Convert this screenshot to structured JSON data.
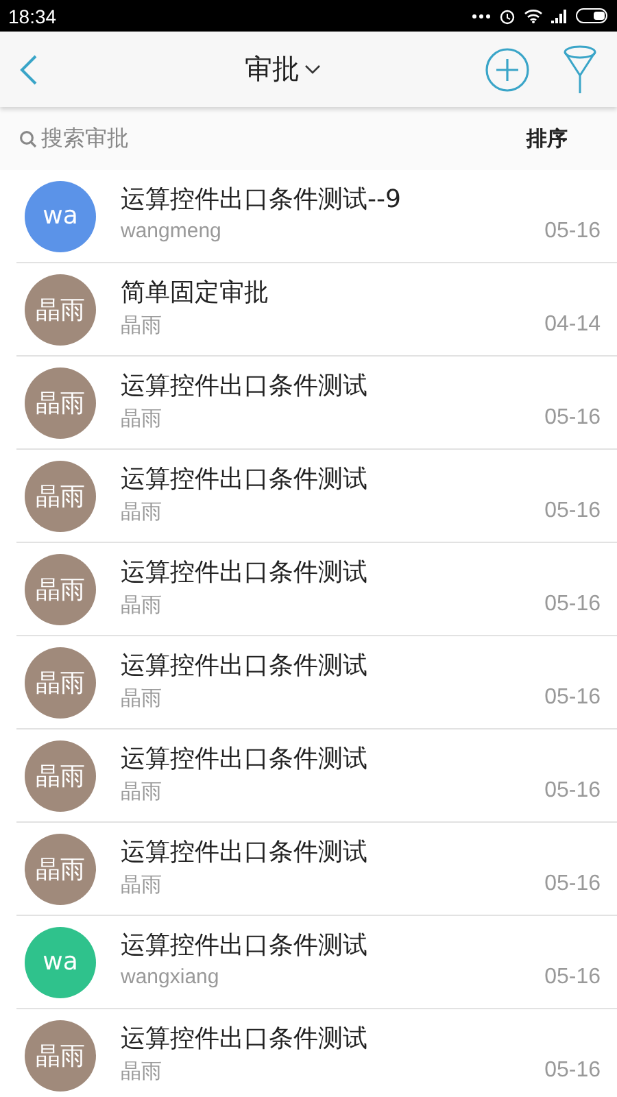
{
  "status_bar": {
    "time": "18:34"
  },
  "header": {
    "title": "审批"
  },
  "search": {
    "placeholder": "搜索审批",
    "sort_label": "排序"
  },
  "items": [
    {
      "avatar": "wa",
      "color": "#5b93e8",
      "title": "运算控件出口条件测试--9",
      "author": "wangmeng",
      "date": "05-16"
    },
    {
      "avatar": "晶雨",
      "color": "#a08a7b",
      "title": "简单固定审批",
      "author": "晶雨",
      "date": "04-14"
    },
    {
      "avatar": "晶雨",
      "color": "#a08a7b",
      "title": "运算控件出口条件测试",
      "author": "晶雨",
      "date": "05-16"
    },
    {
      "avatar": "晶雨",
      "color": "#a08a7b",
      "title": "运算控件出口条件测试",
      "author": "晶雨",
      "date": "05-16"
    },
    {
      "avatar": "晶雨",
      "color": "#a08a7b",
      "title": "运算控件出口条件测试",
      "author": "晶雨",
      "date": "05-16"
    },
    {
      "avatar": "晶雨",
      "color": "#a08a7b",
      "title": "运算控件出口条件测试",
      "author": "晶雨",
      "date": "05-16"
    },
    {
      "avatar": "晶雨",
      "color": "#a08a7b",
      "title": "运算控件出口条件测试",
      "author": "晶雨",
      "date": "05-16"
    },
    {
      "avatar": "晶雨",
      "color": "#a08a7b",
      "title": "运算控件出口条件测试",
      "author": "晶雨",
      "date": "05-16"
    },
    {
      "avatar": "wa",
      "color": "#2fc28c",
      "title": "运算控件出口条件测试",
      "author": "wangxiang",
      "date": "05-16"
    },
    {
      "avatar": "晶雨",
      "color": "#a08a7b",
      "title": "运算控件出口条件测试",
      "author": "晶雨",
      "date": "05-16"
    }
  ]
}
